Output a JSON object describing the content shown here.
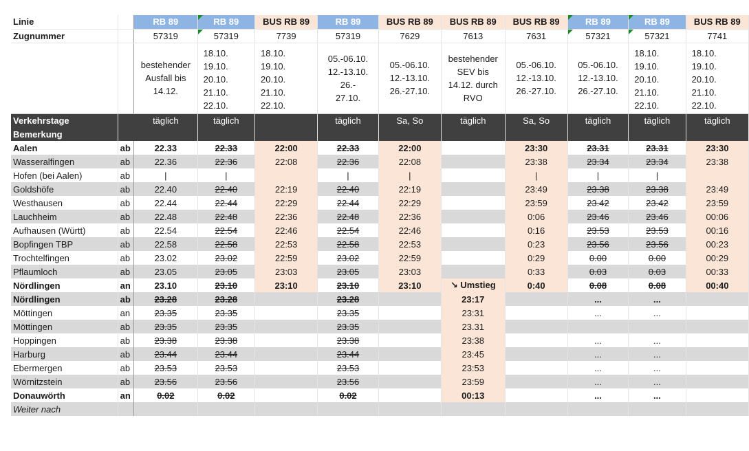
{
  "header": {
    "linie_label": "Linie",
    "zugnummer_label": "Zugnummer",
    "verkehrstage_label": "Verkehrstage",
    "bemerkung_label": "Bemerkung"
  },
  "columns": [
    {
      "linie": "RB 89",
      "zug": "57319",
      "tage": [
        "bestehender",
        "Ausfall bis",
        "14.12."
      ],
      "verkehrstage": "täglich"
    },
    {
      "linie": "RB 89",
      "zug": "57319",
      "tage": [
        "18.10.",
        "19.10.",
        "20.10.",
        "21.10.",
        "22.10."
      ],
      "verkehrstage": "täglich"
    },
    {
      "linie": "BUS RB 89",
      "zug": "7739",
      "tage": [
        "18.10.",
        "19.10.",
        "20.10.",
        "21.10.",
        "22.10."
      ],
      "verkehrstage": ""
    },
    {
      "linie": "RB 89",
      "zug": "57319",
      "tage": [
        "05.-06.10.",
        "12.-13.10. 26.-",
        "27.10."
      ],
      "verkehrstage": "täglich"
    },
    {
      "linie": "BUS RB 89",
      "zug": "7629",
      "tage": [
        "05.-06.10.",
        "12.-13.10.",
        "26.-27.10."
      ],
      "verkehrstage": "Sa, So"
    },
    {
      "linie": "BUS RB 89",
      "zug": "7613",
      "tage": [
        "bestehender",
        "SEV bis",
        "14.12. durch",
        "RVO"
      ],
      "verkehrstage": "täglich"
    },
    {
      "linie": "BUS RB 89",
      "zug": "7631",
      "tage": [
        "05.-06.10.",
        "12.-13.10.",
        "26.-27.10."
      ],
      "verkehrstage": "Sa, So"
    },
    {
      "linie": "RB 89",
      "zug": "57321",
      "tage": [
        "05.-06.10.",
        "12.-13.10.",
        "26.-27.10."
      ],
      "verkehrstage": "täglich"
    },
    {
      "linie": "RB 89",
      "zug": "57321",
      "tage": [
        "18.10.",
        "19.10.",
        "20.10.",
        "21.10.",
        "22.10."
      ],
      "verkehrstage": "täglich"
    },
    {
      "linie": "BUS RB 89",
      "zug": "7741",
      "tage": [
        "18.10.",
        "19.10.",
        "20.10.",
        "21.10.",
        "22.10."
      ],
      "verkehrstage": "täglich"
    }
  ],
  "rows": [
    {
      "station": "Aalen",
      "ab": "ab",
      "times": [
        "22.33",
        "22.33",
        "22:00",
        "22.33",
        "22:00",
        "",
        "23:30",
        "23.31",
        "23.31",
        "23:30"
      ]
    },
    {
      "station": "Wasseralfingen",
      "ab": "ab",
      "times": [
        "22.36",
        "22.36",
        "22:08",
        "22.36",
        "22:08",
        "",
        "23:38",
        "23.34",
        "23.34",
        "23:38"
      ]
    },
    {
      "station": "Hofen (bei Aalen)",
      "ab": "ab",
      "times": [
        "|",
        "|",
        "",
        "|",
        "|",
        "",
        "|",
        "|",
        "|",
        ""
      ]
    },
    {
      "station": "Goldshöfe",
      "ab": "ab",
      "times": [
        "22.40",
        "22.40",
        "22:19",
        "22.40",
        "22:19",
        "",
        "23:49",
        "23.38",
        "23.38",
        "23:49"
      ]
    },
    {
      "station": "Westhausen",
      "ab": "ab",
      "times": [
        "22.44",
        "22.44",
        "22:29",
        "22.44",
        "22:29",
        "",
        "23:59",
        "23.42",
        "23.42",
        "23:59"
      ]
    },
    {
      "station": "Lauchheim",
      "ab": "ab",
      "times": [
        "22.48",
        "22.48",
        "22:36",
        "22.48",
        "22:36",
        "",
        "0:06",
        "23.46",
        "23.46",
        "00:06"
      ]
    },
    {
      "station": "Aufhausen (Württ)",
      "ab": "ab",
      "times": [
        "22.54",
        "22.54",
        "22:46",
        "22.54",
        "22:46",
        "",
        "0:16",
        "23.53",
        "23.53",
        "00:16"
      ]
    },
    {
      "station": "Bopfingen TBP",
      "ab": "ab",
      "times": [
        "22.58",
        "22.58",
        "22:53",
        "22.58",
        "22:53",
        "",
        "0:23",
        "23.56",
        "23.56",
        "00:23"
      ]
    },
    {
      "station": "Trochtelfingen",
      "ab": "ab",
      "times": [
        "23.02",
        "23.02",
        "22:59",
        "23.02",
        "22:59",
        "",
        "0:29",
        "0.00",
        "0.00",
        "00:29"
      ]
    },
    {
      "station": "Pflaumloch",
      "ab": "ab",
      "times": [
        "23.05",
        "23.05",
        "23:03",
        "23.05",
        "23:03",
        "",
        "0:33",
        "0.03",
        "0.03",
        "00:33"
      ]
    },
    {
      "station": "Nördlingen",
      "ab": "an",
      "times": [
        "23.10",
        "23.10",
        "23:10",
        "23.10",
        "23:10",
        "Umstieg",
        "0:40",
        "0.08",
        "0.08",
        "00:40"
      ]
    },
    {
      "station": "Nördlingen",
      "ab": "ab",
      "times": [
        "23.28",
        "23.28",
        "",
        "23.28",
        "",
        "23:17",
        "",
        "...",
        "...",
        ""
      ]
    },
    {
      "station": "Möttingen",
      "ab": "an",
      "times": [
        "23.35",
        "23.35",
        "",
        "23.35",
        "",
        "23:31",
        "",
        "...",
        "...",
        ""
      ]
    },
    {
      "station": "Möttingen",
      "ab": "ab",
      "times": [
        "23.35",
        "23.35",
        "",
        "23.35",
        "",
        "23.31",
        "",
        "",
        "",
        ""
      ]
    },
    {
      "station": "Hoppingen",
      "ab": "ab",
      "times": [
        "23.38",
        "23.38",
        "",
        "23.38",
        "",
        "23:38",
        "",
        "...",
        "...",
        ""
      ]
    },
    {
      "station": "Harburg",
      "ab": "ab",
      "times": [
        "23.44",
        "23.44",
        "",
        "23.44",
        "",
        "23:45",
        "",
        "...",
        "...",
        ""
      ]
    },
    {
      "station": "Ebermergen",
      "ab": "ab",
      "times": [
        "23.53",
        "23.53",
        "",
        "23.53",
        "",
        "23:53",
        "",
        "...",
        "...",
        ""
      ]
    },
    {
      "station": "Wörnitzstein",
      "ab": "ab",
      "times": [
        "23.56",
        "23.56",
        "",
        "23.56",
        "",
        "23:59",
        "",
        "...",
        "...",
        ""
      ]
    },
    {
      "station": "Donauwörth",
      "ab": "an",
      "times": [
        "0.02",
        "0.02",
        "",
        "0.02",
        "",
        "00:13",
        "",
        "...",
        "...",
        ""
      ]
    },
    {
      "station": "Weiter nach",
      "ab": "",
      "times": [
        "",
        "",
        "",
        "",
        "",
        "",
        "",
        "",
        "",
        ""
      ]
    }
  ],
  "colors": {
    "blue_header": "#8eb4e3",
    "peach": "#fbe5d6",
    "gray_row": "#d9d9d9",
    "dark_band": "#404040",
    "green_marker": "#1a8a2a"
  }
}
